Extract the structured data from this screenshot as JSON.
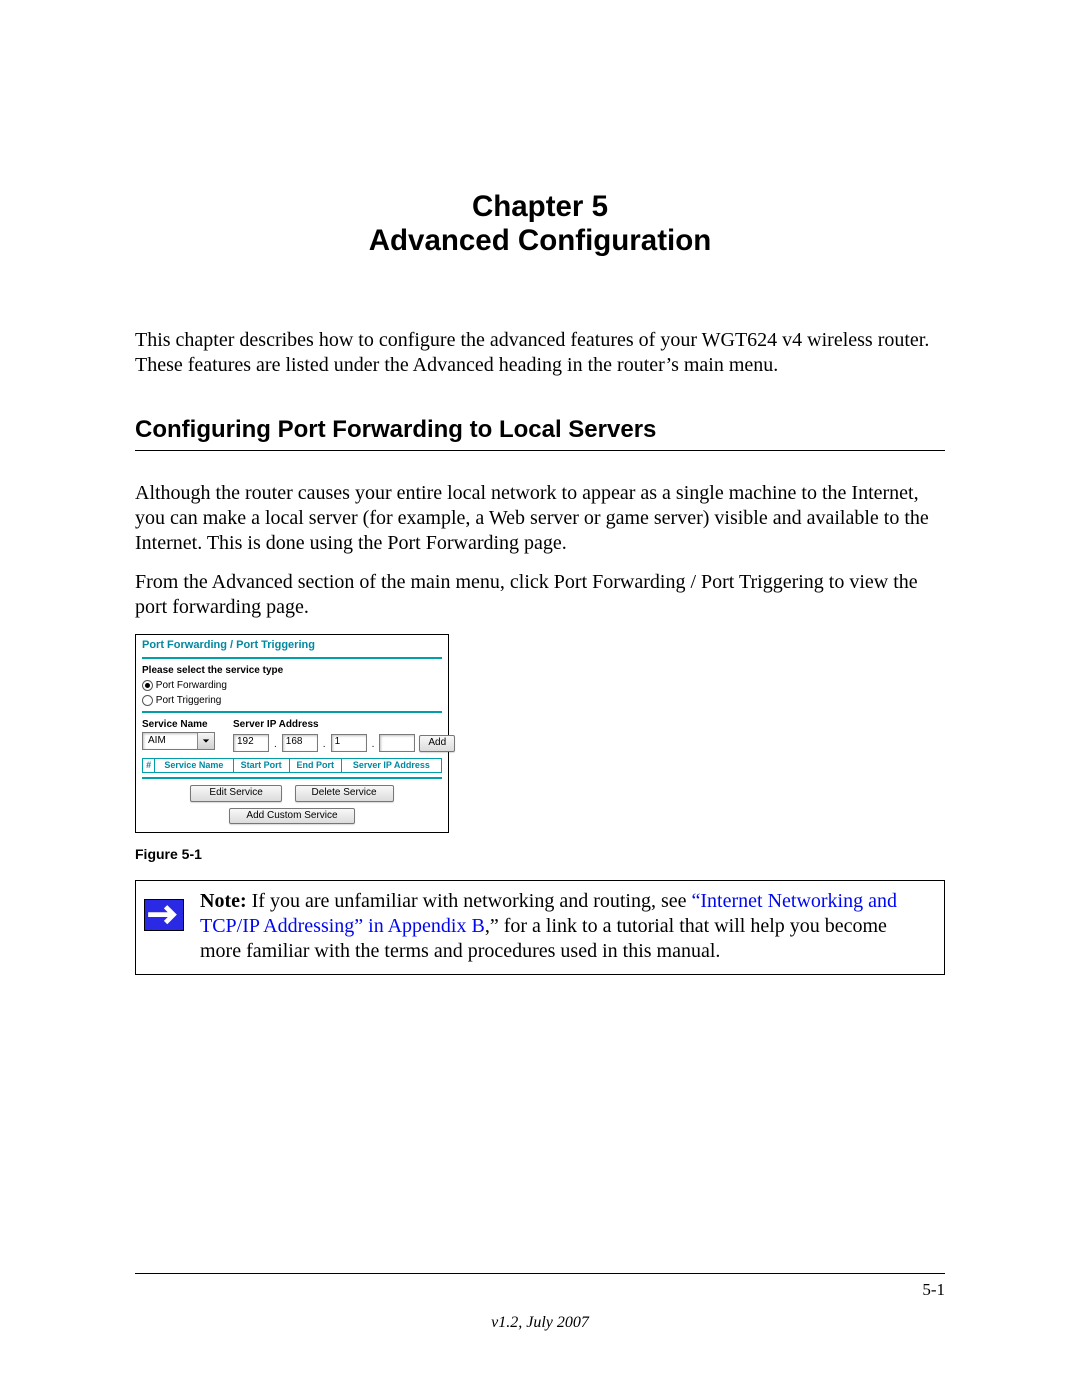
{
  "chapter": {
    "line1": "Chapter 5",
    "title": "Advanced Configuration"
  },
  "intro": "This chapter describes how to configure the advanced features of your WGT624 v4 wireless router. These features are listed under the Advanced heading in the router’s main menu.",
  "section": {
    "heading": "Configuring Port Forwarding to Local Servers",
    "p1": "Although the router causes your entire local network to appear as a single machine to the Internet, you can make a local server (for example, a Web server or game server) visible and available to the Internet. This is done using the Port Forwarding page.",
    "p2": "From the Advanced section of the main menu, click Port Forwarding / Port Triggering to view the port forwarding page."
  },
  "router": {
    "title": "Port Forwarding / Port Triggering",
    "select_service_label": "Please select the service type",
    "option_forwarding": "Port Forwarding",
    "option_triggering": "Port Triggering",
    "service_name_label": "Service Name",
    "service_selected": "AIM",
    "server_ip_label": "Server IP Address",
    "ip": {
      "a": "192",
      "b": "168",
      "c": "1",
      "d": ""
    },
    "add_btn": "Add",
    "cols": {
      "num": "#",
      "svc": "Service Name",
      "start": "Start Port",
      "end": "End Port",
      "ip": "Server IP Address"
    },
    "edit_btn": "Edit Service",
    "delete_btn": "Delete Service",
    "custom_btn": "Add Custom Service"
  },
  "figure_caption": "Figure 5-1",
  "note": {
    "bold": "Note:",
    "t1": " If you are unfamiliar with networking and routing, see ",
    "link": "“Internet Networking and TCP/IP Addressing” in Appendix B",
    "t2": ",” for a link to a tutorial that will help you become more familiar with the terms and procedures used in this manual."
  },
  "footer": {
    "page": "5-1",
    "version": "v1.2, July 2007"
  }
}
